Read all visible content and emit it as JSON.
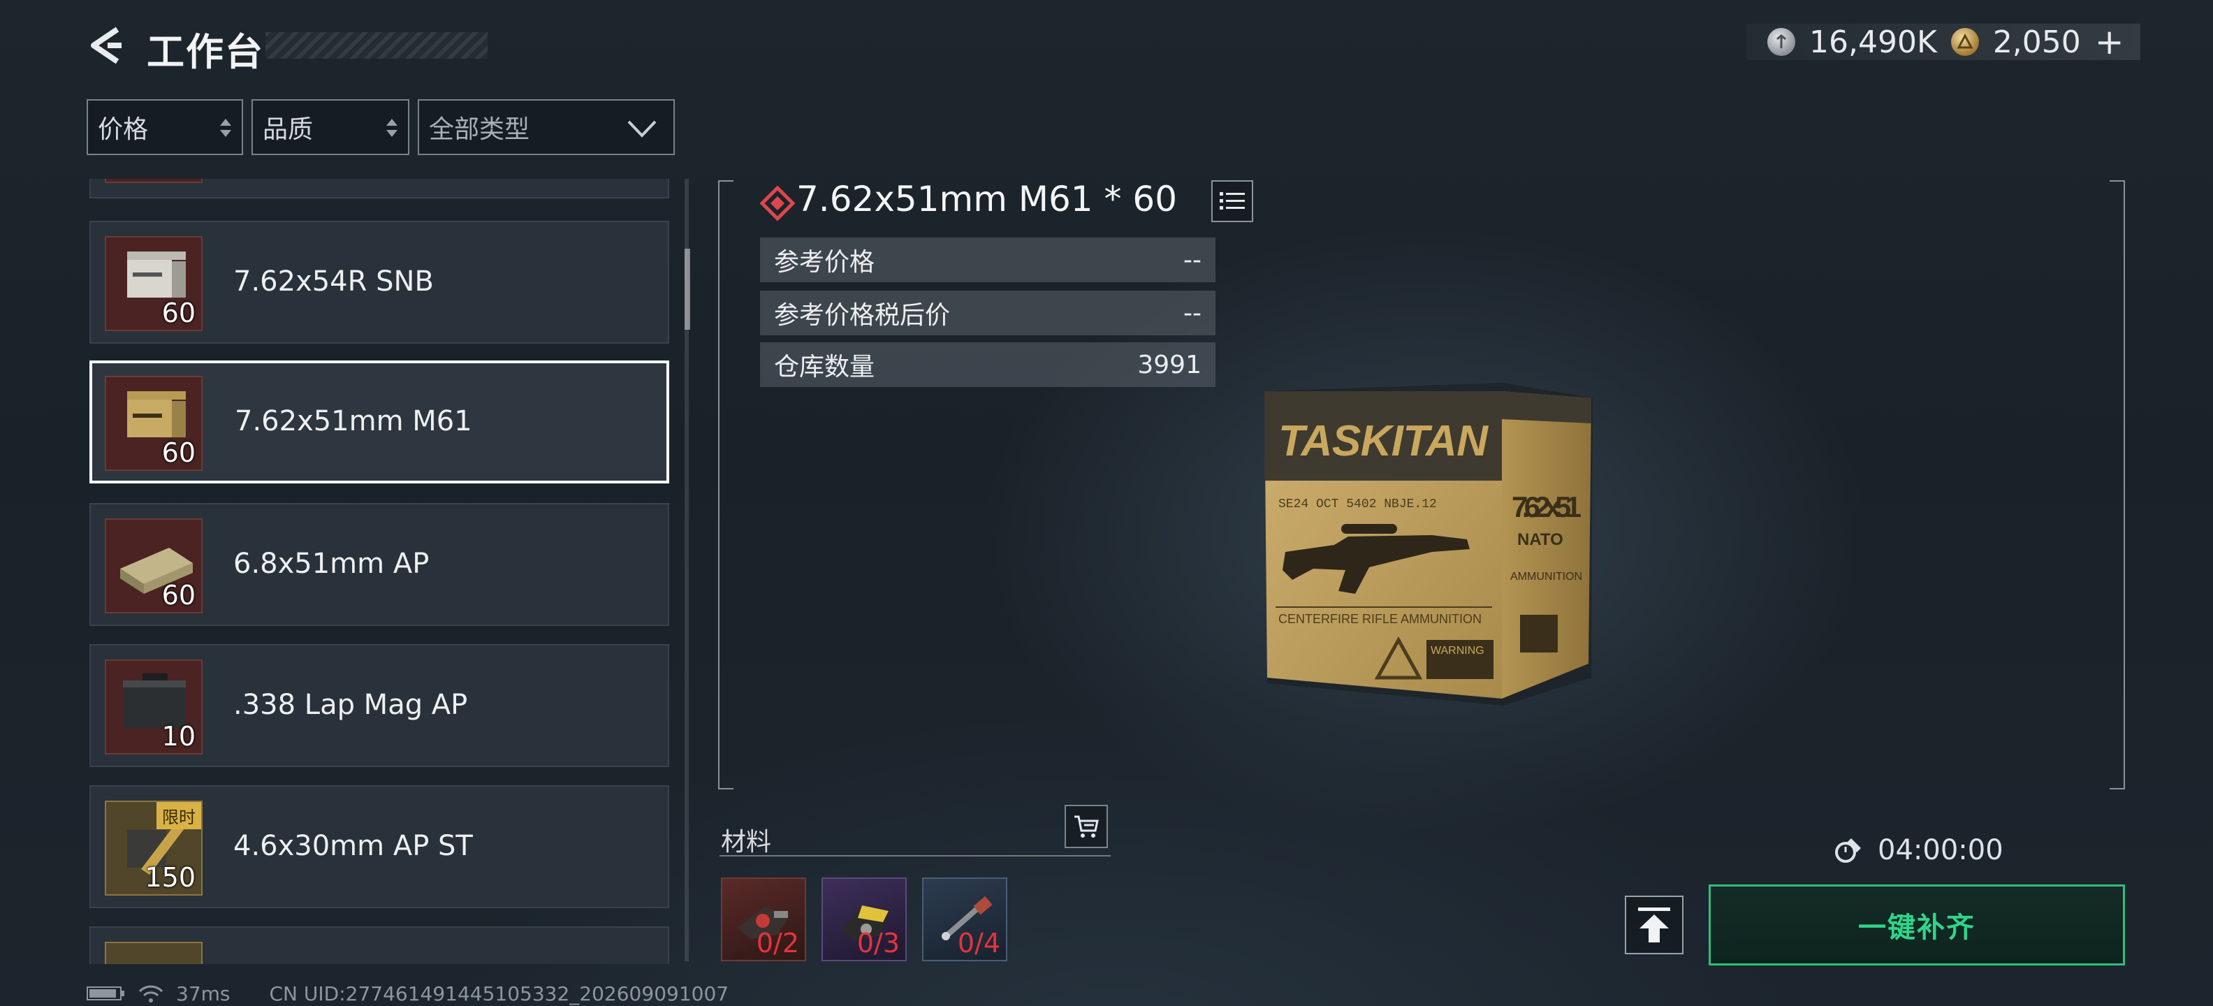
{
  "header": {
    "title": "工作台",
    "back_icon": "back-arrow-icon",
    "currency": [
      {
        "icon": "silver-coin-icon",
        "value": "16,490K"
      },
      {
        "icon": "gold-coin-icon",
        "value": "2,050"
      }
    ],
    "add_label": "+"
  },
  "filters": {
    "price_label": "价格",
    "quality_label": "品质",
    "type_label": "全部类型"
  },
  "items": [
    {
      "name": "7.62x54R SNB",
      "count": "60",
      "selected": false
    },
    {
      "name": "7.62x51mm M61",
      "count": "60",
      "selected": true
    },
    {
      "name": "6.8x51mm AP",
      "count": "60",
      "selected": false
    },
    {
      "name": ".338 Lap Mag AP",
      "count": "10",
      "selected": false
    },
    {
      "name": "4.6x30mm AP ST",
      "count": "150",
      "selected": false,
      "badge": "限时"
    }
  ],
  "detail": {
    "title": "7.62x51mm M61 * 60",
    "rows": [
      {
        "label": "参考价格",
        "value": "--"
      },
      {
        "label": "参考价格税后价",
        "value": "--"
      },
      {
        "label": "仓库数量",
        "value": "3991"
      }
    ],
    "box_brand": "TASKITAN",
    "box_caliber": "7.62x51",
    "box_nato": "NATO",
    "box_code": "SE24 OCT 5402 NBJE.12",
    "box_ammo": "AMMUNITION",
    "box_warning": "WARNING",
    "box_bottom": "CENTERFIRE RIFLE AMMUNITION"
  },
  "materials": {
    "label": "材料",
    "slots": [
      {
        "count": "0/2",
        "icon": "red-component-icon"
      },
      {
        "count": "0/3",
        "icon": "yellow-component-icon"
      },
      {
        "count": "0/4",
        "icon": "tool-component-icon"
      }
    ]
  },
  "craft": {
    "time": "04:00:00",
    "refill_label": "一键补齐"
  },
  "status": {
    "ping": "37ms",
    "uid": "CN UID:277461491445105332_202609091007"
  },
  "colors": {
    "accent_green": "#2fd58a",
    "missing_red": "#e5333c",
    "thumb_bg": "#4a2322"
  }
}
